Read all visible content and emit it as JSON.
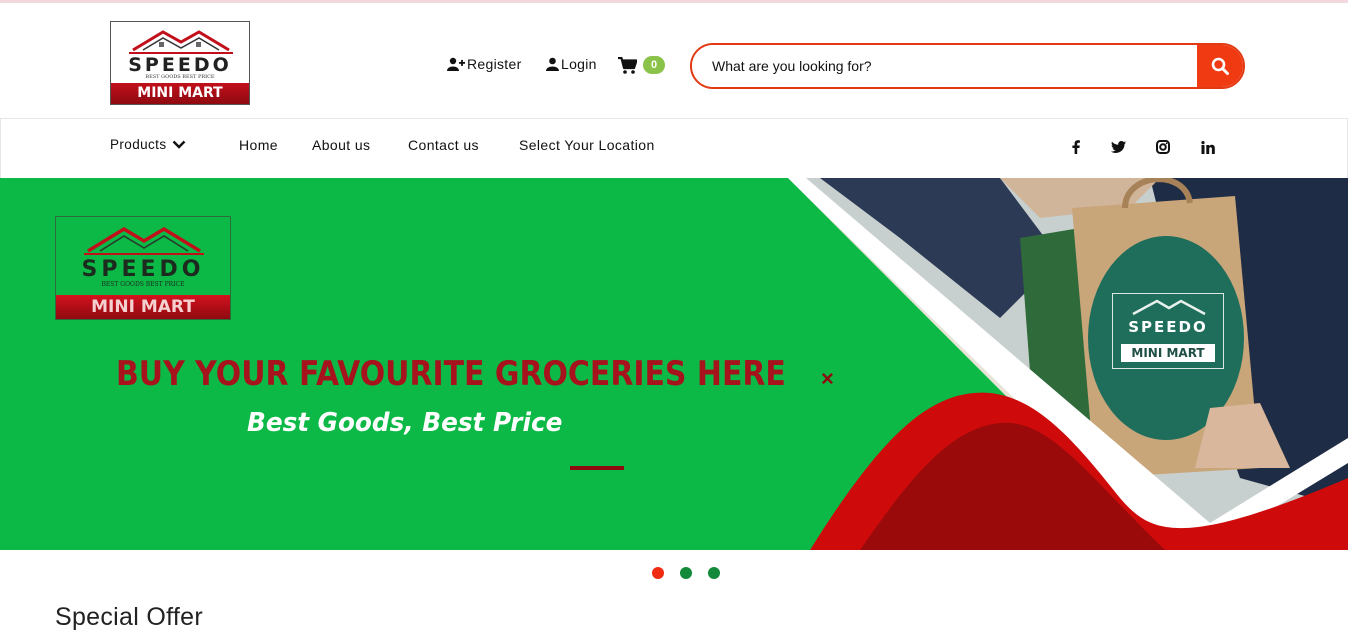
{
  "header": {
    "logo": {
      "brand": "SPEEDO",
      "tagline": "BEST GOODS BEST PRICE",
      "subtitle": "MINI MART"
    },
    "register_label": "Register",
    "login_label": "Login",
    "cart_count": "0",
    "search": {
      "placeholder": "What are you looking for?",
      "value": ""
    },
    "icons": [
      "user-plus-icon",
      "user-icon",
      "cart-icon",
      "search-icon"
    ]
  },
  "nav": {
    "products_label": "Products",
    "items": [
      {
        "label": "Home"
      },
      {
        "label": "About us"
      },
      {
        "label": "Contact us"
      },
      {
        "label": "Select Your Location"
      }
    ],
    "social": [
      "facebook-icon",
      "twitter-icon",
      "instagram-icon",
      "linkedin-icon"
    ]
  },
  "banner": {
    "logo": {
      "brand": "SPEEDO",
      "tagline": "BEST GOODS BEST PRICE",
      "subtitle": "MINI MART"
    },
    "headline": "BUY YOUR FAVOURITE GROCERIES HERE",
    "subline": "Best Goods, Best Price",
    "close_symbol": "×",
    "bag_logo": {
      "brand": "SPEEDO",
      "subtitle": "MINI MART"
    },
    "slide_count": 3,
    "active_slide": 1
  },
  "section": {
    "title": "Special Offer"
  },
  "colors": {
    "accent": "#ef2b12",
    "green": "#0cb846",
    "dark_red": "#8e0a10",
    "badge": "#8bc34a"
  }
}
